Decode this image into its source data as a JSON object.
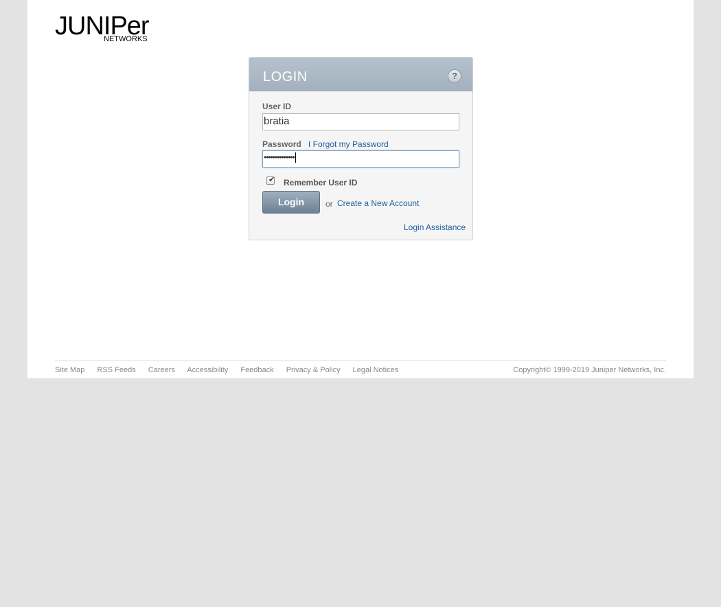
{
  "logo": {
    "word": "JUNIPer",
    "sub": "NETWORKS"
  },
  "login": {
    "title": "LOGIN",
    "help_glyph": "?",
    "user_id_label": "User ID",
    "user_id_value": "bratia",
    "password_label": "Password",
    "forgot_link": "I Forgot my Password",
    "password_mask": "••••••••••••••",
    "remember_checked": true,
    "remember_label": "Remember User ID",
    "login_button": "Login",
    "or_text": "or",
    "create_account_link": "Create a New Account",
    "assistance_link": "Login Assistance"
  },
  "footer": {
    "links": [
      "Site Map",
      "RSS Feeds",
      "Careers",
      "Accessibility",
      "Feedback",
      "Privacy & Policy",
      "Legal Notices"
    ],
    "copyright": "Copyright© 1999-2019 Juniper Networks, Inc."
  },
  "colors": {
    "header_bar": "#a3b1bf",
    "link": "#1f5d9e",
    "page_background": "#e3e3e3"
  },
  "icons": [
    "help-icon",
    "checkbox-checked-icon"
  ]
}
